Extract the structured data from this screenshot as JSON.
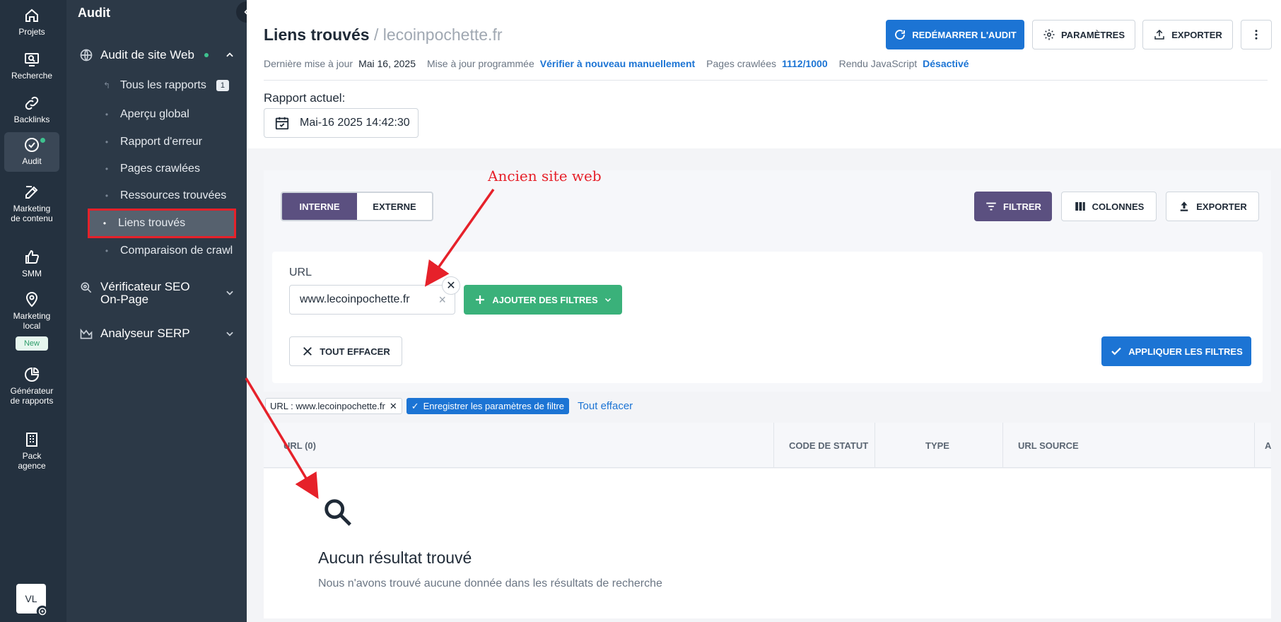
{
  "rail": {
    "items": [
      {
        "label": "Projets",
        "icon": "home-icon"
      },
      {
        "label": "Recherche",
        "icon": "search-screen-icon"
      },
      {
        "label": "Backlinks",
        "icon": "link-icon"
      },
      {
        "label": "Audit",
        "icon": "check-circle-icon"
      },
      {
        "label": "Marketing de contenu",
        "icon": "edit-icon"
      },
      {
        "label": "SMM",
        "icon": "thumbs-up-icon"
      },
      {
        "label": "Marketing local",
        "icon": "map-pin-icon"
      },
      {
        "label": "Générateur de rapports",
        "icon": "pie-chart-icon"
      },
      {
        "label": "Pack agence",
        "icon": "building-icon"
      }
    ],
    "new_badge": "New",
    "avatar": "VL"
  },
  "sidebar": {
    "title": "Audit",
    "group_audit": "Audit de site Web",
    "items": [
      {
        "label": "Tous les rapports",
        "badge": "1"
      },
      {
        "label": "Aperçu global"
      },
      {
        "label": "Rapport d'erreur"
      },
      {
        "label": "Pages crawlées"
      },
      {
        "label": "Ressources trouvées"
      },
      {
        "label": "Liens trouvés"
      },
      {
        "label": "Comparaison de crawl"
      }
    ],
    "group_seo": "Vérificateur SEO On-Page",
    "group_serp": "Analyseur SERP"
  },
  "header": {
    "title": "Liens trouvés",
    "domain": "/ lecoinpochette.fr",
    "meta": {
      "last_update_label": "Dernière mise à jour",
      "last_update_value": "Mai 16, 2025",
      "scheduled_label": "Mise à jour programmée",
      "scheduled_value": "Vérifier à nouveau manuellement",
      "pages_label": "Pages crawlées",
      "pages_value": "1112/1000",
      "js_label": "Rendu JavaScript",
      "js_value": "Désactivé"
    },
    "buttons": {
      "restart": "REDÉMARRER L'AUDIT",
      "settings": "PARAMÈTRES",
      "export": "EXPORTER"
    },
    "report_label": "Rapport actuel:",
    "report_date": "Mai-16 2025 14:42:30"
  },
  "toolbar": {
    "tab_internal": "INTERNE",
    "tab_external": "EXTERNE",
    "filter": "FILTRER",
    "columns": "COLONNES",
    "export": "EXPORTER"
  },
  "filters": {
    "url_label": "URL",
    "url_value": "www.lecoinpochette.fr",
    "add_filters": "AJOUTER DES FILTRES",
    "clear_all": "TOUT EFFACER",
    "apply": "APPLIQUER LES FILTRES",
    "active_tag": "URL : www.lecoinpochette.fr",
    "save_settings": "Enregistrer les paramètres de filtre",
    "clear_link": "Tout effacer"
  },
  "table": {
    "columns": [
      "URL  (0)",
      "CODE DE STATUT",
      "TYPE",
      "URL SOURCE",
      "A"
    ],
    "empty_title": "Aucun résultat trouvé",
    "empty_subtitle": "Nous n'avons trouvé aucune donnée dans les résultats de recherche"
  },
  "annotation": {
    "text": "Ancien site web",
    "color": "#e6212a"
  },
  "colors": {
    "accent_blue": "#1c74d4",
    "purple": "#5b5080",
    "green": "#3ab17a",
    "rail_bg": "#24313f",
    "sidebar_bg": "#2c3947"
  }
}
